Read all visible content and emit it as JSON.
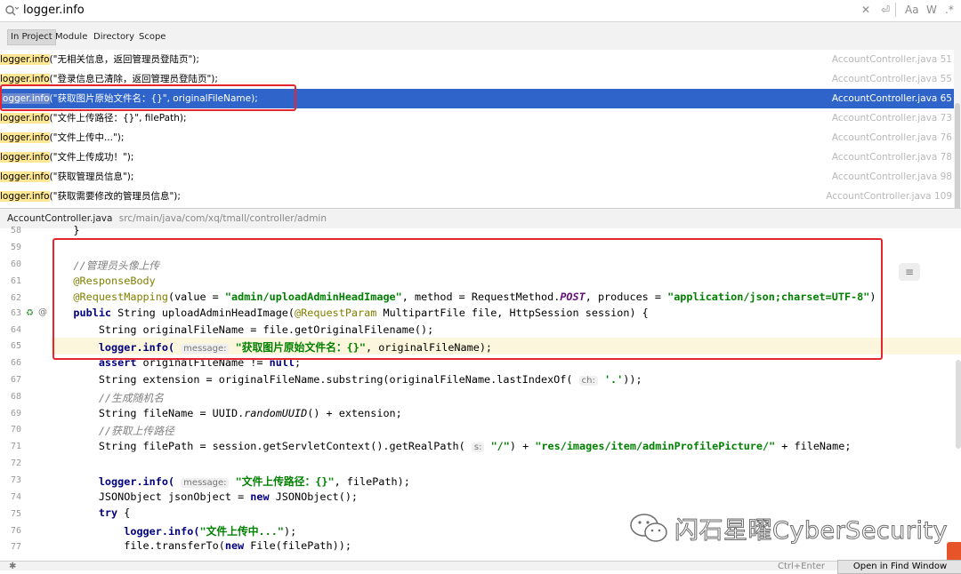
{
  "search": {
    "query": "logger.info"
  },
  "search_tools": {
    "match_case": "Aa",
    "words": "W",
    "regex": ".*"
  },
  "scope_tabs": [
    {
      "label": "In Project",
      "active": true
    },
    {
      "label": "Module"
    },
    {
      "label": "Directory"
    },
    {
      "label": "Scope"
    }
  ],
  "results": [
    {
      "match": "logger.info",
      "rest": "(\"无相关信息，返回管理员登陆页\");",
      "file": "AccountController.java 51"
    },
    {
      "match": "logger.info",
      "rest": "(\"登录信息已清除，返回管理员登陆页\");",
      "file": "AccountController.java 55"
    },
    {
      "match": "logger.info",
      "rest": "(\"获取图片原始文件名：{}\", originalFileName);",
      "file": "AccountController.java 65",
      "selected": true
    },
    {
      "match": "logger.info",
      "rest": "(\"文件上传路径：{}\", filePath);",
      "file": "AccountController.java 73"
    },
    {
      "match": "logger.info",
      "rest": "(\"文件上传中...\");",
      "file": "AccountController.java 76"
    },
    {
      "match": "logger.info",
      "rest": "(\"文件上传成功！\");",
      "file": "AccountController.java 78"
    },
    {
      "match": "logger.info",
      "rest": "(\"获取管理员信息\");",
      "file": "AccountController.java 98"
    },
    {
      "match": "logger.info",
      "rest": "(\"获取需要修改的管理员信息\");",
      "file": "AccountController.java 109"
    }
  ],
  "preview": {
    "file": "AccountController.java",
    "path": "src/main/java/com/xq/tmall/controller/admin"
  },
  "editor": {
    "line_numbers": [
      "58",
      "59",
      "60",
      "61",
      "62",
      "63",
      "64",
      "65",
      "66",
      "67",
      "68",
      "69",
      "70",
      "71",
      "72",
      "73",
      "74",
      "75",
      "76",
      "77"
    ],
    "code": {
      "l58": "    }",
      "l60_comment": "//管理员头像上传",
      "l61_ann": "@ResponseBody",
      "l62_ann": "@RequestMapping",
      "l62_a": "(value = ",
      "l62_s1": "\"admin/uploadAdminHeadImage\"",
      "l62_b": ", method = RequestMethod.",
      "l62_post": "POST",
      "l62_c": ", produces = ",
      "l62_s2": "\"application/json;charset=UTF-8\"",
      "l62_d": ")",
      "l63_kw": "public",
      "l63_a": " String uploadAdminHeadImage(",
      "l63_ann": "@RequestParam",
      "l63_b": " MultipartFile file, HttpSession session) {",
      "l64": "        String originalFileName = file.getOriginalFilename();",
      "l65_call": "logger.info(",
      "l65_hint": "message:",
      "l65_str": "\"获取图片原始文件名：{}\"",
      "l65_end": ", originalFileName);",
      "l66_kw": "assert",
      "l66_a": " originalFileName != ",
      "l66_null": "null",
      "l66_b": ";",
      "l67_a": "        String extension = originalFileName.substring(originalFileName.lastIndexOf(",
      "l67_hint": "ch:",
      "l67_str": "'.'",
      "l67_b": "));",
      "l68_comment": "//生成随机名",
      "l69_a": "        String fileName = UUID.",
      "l69_it": "randomUUID",
      "l69_b": "() + extension;",
      "l70_comment": "//获取上传路径",
      "l71_a": "        String filePath = session.getServletContext().getRealPath(",
      "l71_hint": "s:",
      "l71_s1": "\"/\"",
      "l71_b": ") + ",
      "l71_s2": "\"res/images/item/adminProfilePicture/\"",
      "l71_c": " + fileName;",
      "l73_call": "logger.info(",
      "l73_hint": "message:",
      "l73_str": "\"文件上传路径：{}\"",
      "l73_end": ", filePath);",
      "l74_a": "        JSONObject jsonObject = ",
      "l74_kw": "new",
      "l74_b": " JSONObject();",
      "l75_kw": "try",
      "l75_b": " {",
      "l76_call": "logger.info(",
      "l76_str": "\"文件上传中...\"",
      "l76_end": ");",
      "l77_a": "            file.transferTo(",
      "l77_kw": "new",
      "l77_b": " File(filePath));"
    }
  },
  "bottom": {
    "hint": "Ctrl+Enter",
    "open_button": "Open in Find Window"
  },
  "watermark": {
    "text": "闪石星曜CyberSecurity"
  },
  "colors": {
    "selection": "#2f65ca",
    "match_highlight": "#ffe793",
    "annotation_box": "#e5262e"
  }
}
